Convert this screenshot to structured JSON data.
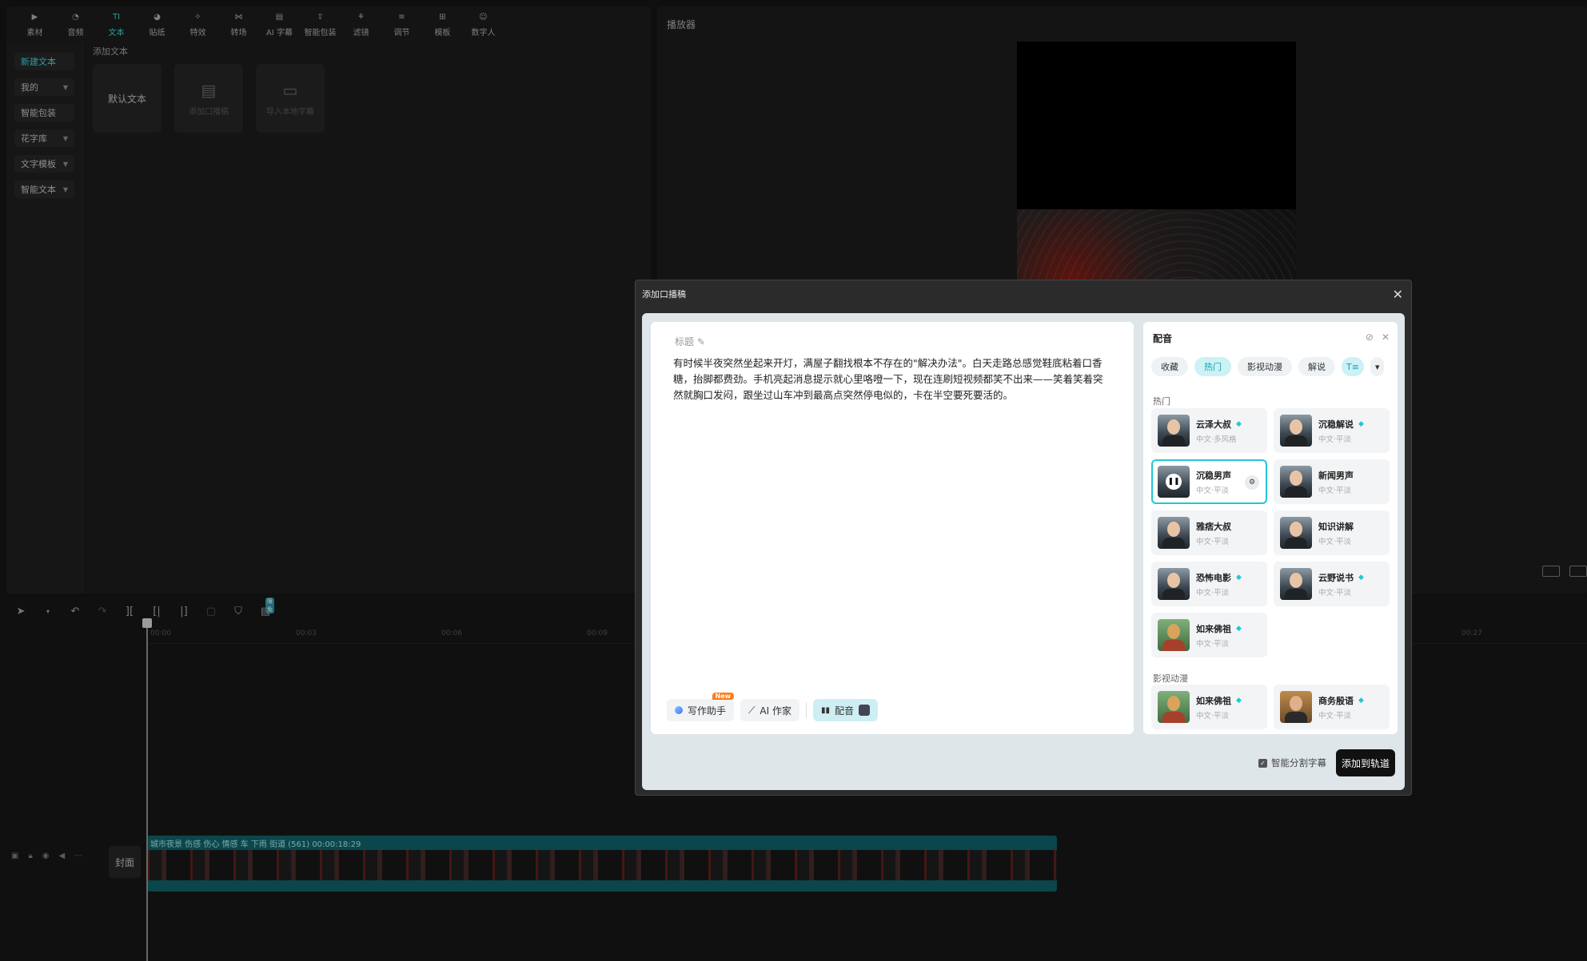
{
  "toolbar": {
    "tabs": [
      {
        "label": "素材",
        "icon": "media-icon"
      },
      {
        "label": "音频",
        "icon": "audio-icon"
      },
      {
        "label": "文本",
        "icon": "text-icon"
      },
      {
        "label": "贴纸",
        "icon": "sticker-icon"
      },
      {
        "label": "特效",
        "icon": "effects-icon"
      },
      {
        "label": "转场",
        "icon": "transition-icon"
      },
      {
        "label": "AI 字幕",
        "icon": "ai-caption-icon"
      },
      {
        "label": "智能包装",
        "icon": "smart-pack-icon"
      },
      {
        "label": "滤镜",
        "icon": "filter-icon"
      },
      {
        "label": "调节",
        "icon": "adjust-icon"
      },
      {
        "label": "模板",
        "icon": "template-icon"
      },
      {
        "label": "数字人",
        "icon": "digital-human-icon"
      }
    ],
    "active_tab": "文本"
  },
  "text_sidebar": {
    "items": [
      {
        "label": "新建文本",
        "has_chevron": false
      },
      {
        "label": "我的",
        "has_chevron": true
      },
      {
        "label": "智能包装",
        "has_chevron": false
      },
      {
        "label": "花字库",
        "has_chevron": true
      },
      {
        "label": "文字模板",
        "has_chevron": true
      },
      {
        "label": "智能文本",
        "has_chevron": true
      }
    ]
  },
  "text_panel": {
    "section_title": "添加文本",
    "cards": [
      {
        "label": "默认文本"
      },
      {
        "label": "添加口播稿"
      },
      {
        "label": "导入本地字幕"
      }
    ]
  },
  "player": {
    "title": "播放器"
  },
  "timeline": {
    "ruler_ticks": [
      "00:00",
      "00:03",
      "00:06",
      "00:09",
      "00:27"
    ],
    "free_badge": "限免",
    "cover_label": "封面",
    "clip_label": "城市夜景 伤感 伤心 情感 车 下雨 街道 (561)  00:00:18:29"
  },
  "dialog": {
    "title": "添加口播稿",
    "editor": {
      "title_placeholder": "标题",
      "body": "有时候半夜突然坐起来开灯，满屋子翻找根本不存在的\"解决办法\"。白天走路总感觉鞋底粘着口香糖，抬脚都费劲。手机亮起消息提示就心里咯噔一下，现在连刷短视频都笑不出来——笑着笑着突然就胸口发闷，跟坐过山车冲到最高点突然停电似的，卡在半空要死要活的。",
      "writing_assistant": "写作助手",
      "new_badge": "New",
      "ai_writer": "AI 作家",
      "dubbing": "配音"
    },
    "voice_panel": {
      "title": "配音",
      "tabs": [
        "收藏",
        "热门",
        "影视动漫",
        "解说"
      ],
      "active_tab": "热门",
      "hot_section": "热门",
      "hot_voices": [
        {
          "name": "云泽大叔",
          "desc": "中文·多风格",
          "vip": true,
          "avatar": "man"
        },
        {
          "name": "沉稳解说",
          "desc": "中文·平淡",
          "vip": true,
          "avatar": "man"
        },
        {
          "name": "沉稳男声",
          "desc": "中文·平淡",
          "vip": false,
          "avatar": "play",
          "selected": true
        },
        {
          "name": "新闻男声",
          "desc": "中文·平淡",
          "vip": false,
          "avatar": "man"
        },
        {
          "name": "雅痞大叔",
          "desc": "中文·平淡",
          "vip": false,
          "avatar": "man"
        },
        {
          "name": "知识讲解",
          "desc": "中文·平淡",
          "vip": false,
          "avatar": "man"
        },
        {
          "name": "恐怖电影",
          "desc": "中文·平淡",
          "vip": true,
          "avatar": "man"
        },
        {
          "name": "云野说书",
          "desc": "中文·平淡",
          "vip": true,
          "avatar": "man"
        },
        {
          "name": "如来佛祖",
          "desc": "中文·平淡",
          "vip": true,
          "avatar": "buddha"
        }
      ],
      "film_section": "影视动漫",
      "film_voices": [
        {
          "name": "如来佛祖",
          "desc": "中文·平淡",
          "vip": true,
          "avatar": "buddha"
        },
        {
          "name": "商务殷语",
          "desc": "中文·平淡",
          "vip": true,
          "avatar": "biz"
        }
      ]
    },
    "smart_split_label": "智能分割字幕",
    "smart_split_checked": true,
    "add_to_track": "添加到轨道"
  }
}
